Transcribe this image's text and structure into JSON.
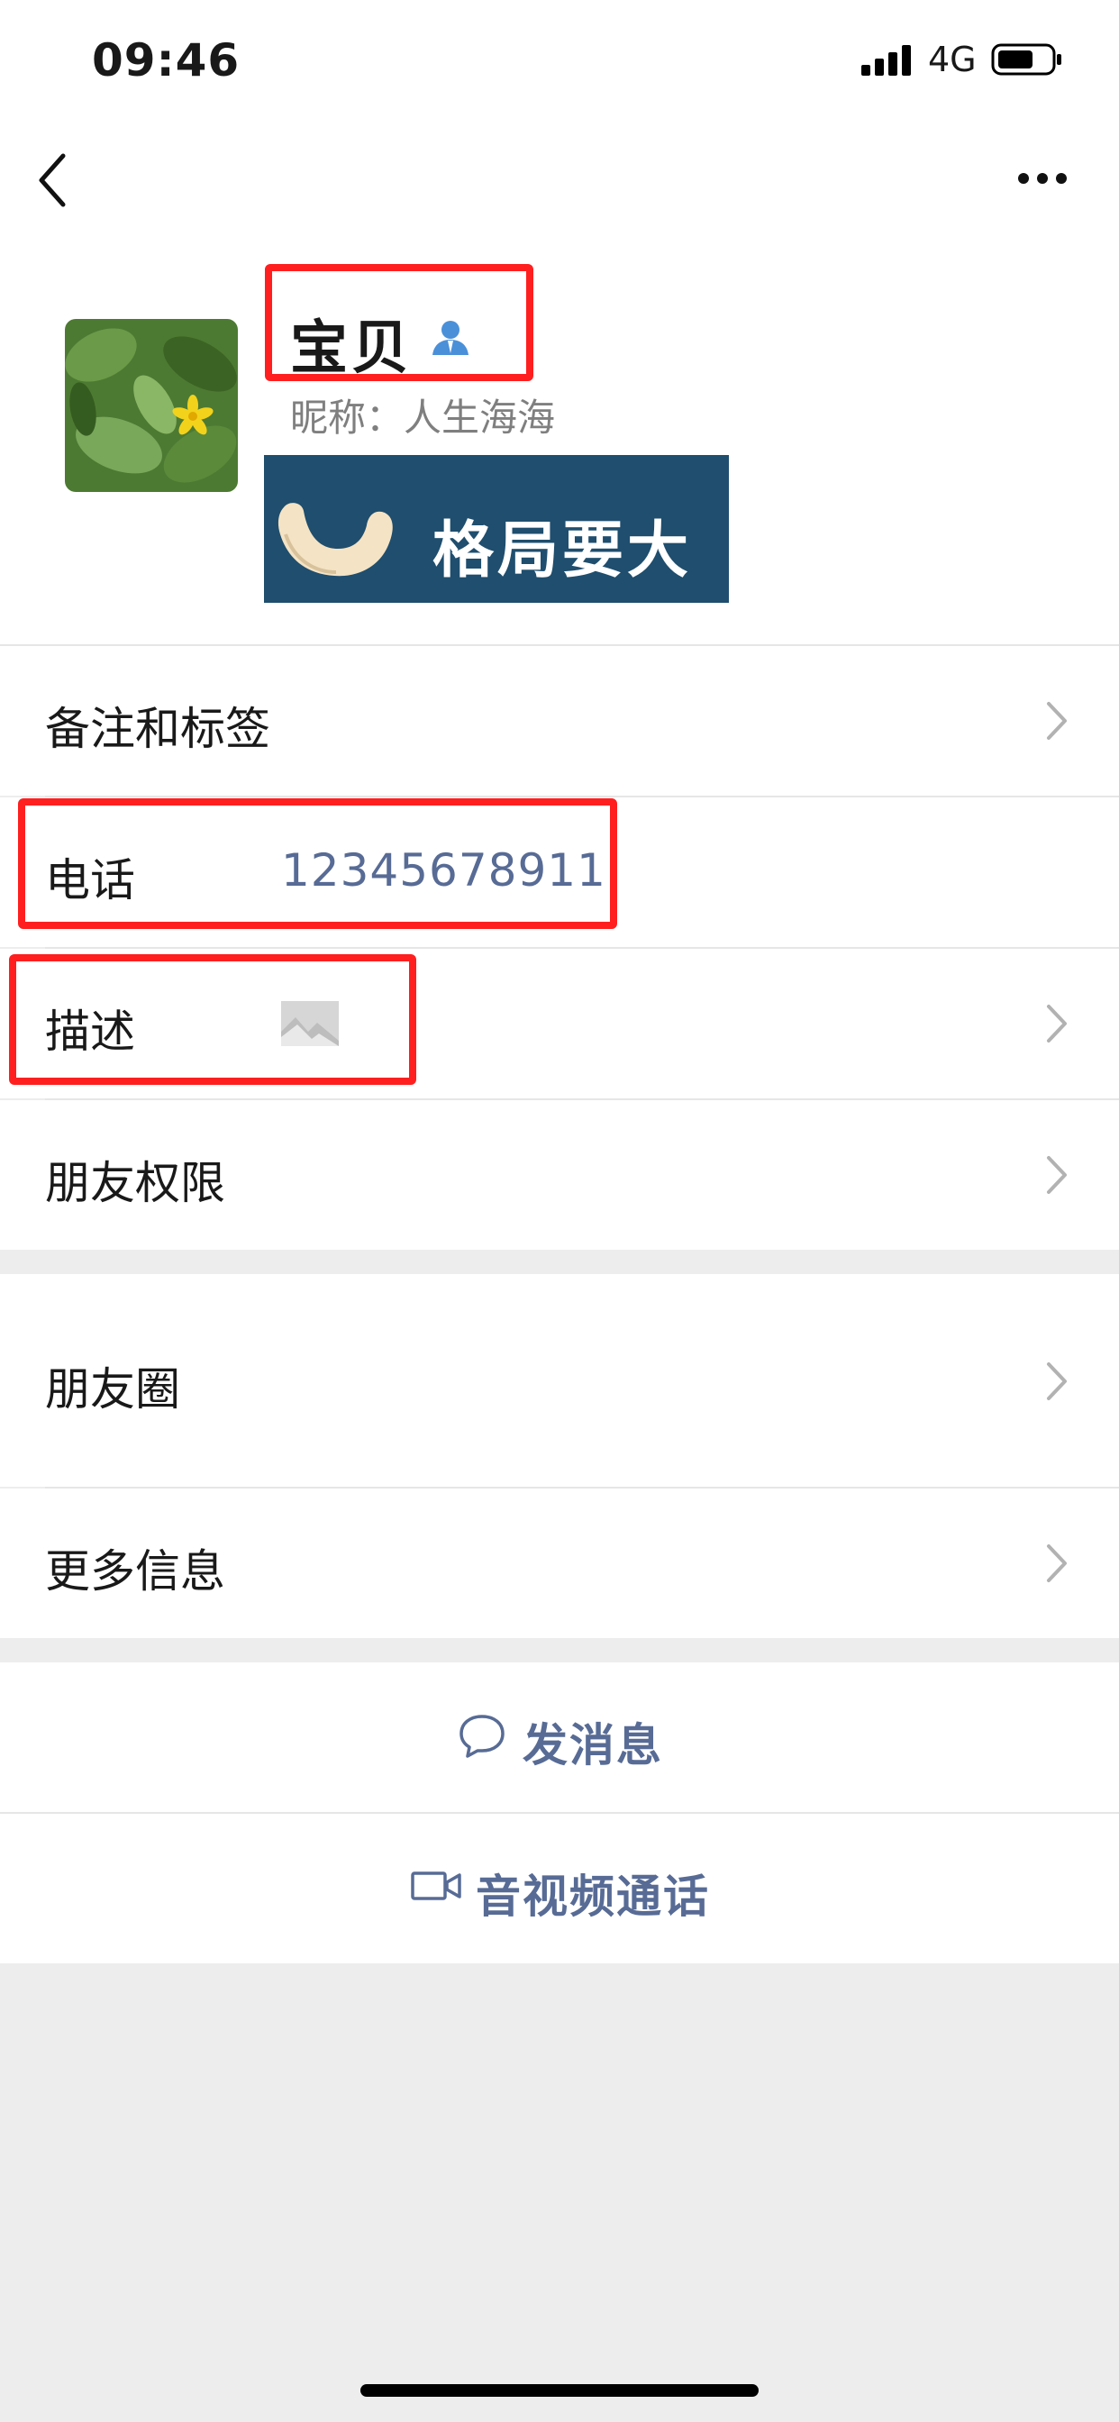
{
  "status_bar": {
    "time": "09:46",
    "network": "4G"
  },
  "profile": {
    "name": "宝贝",
    "nickname": "昵称：人生海海",
    "sticker_text": "格局要大"
  },
  "rows": {
    "remarks_tags": "备注和标签",
    "phone_label": "电话",
    "phone_value": "12345678911",
    "description_label": "描述",
    "friend_permissions": "朋友权限",
    "moments": "朋友圈",
    "more_info": "更多信息"
  },
  "actions": {
    "send_message": "发消息",
    "av_call": "音视频通话"
  },
  "colors": {
    "highlight": "#ff1f1f",
    "link_blue": "#576b95",
    "background": "#ededed"
  }
}
